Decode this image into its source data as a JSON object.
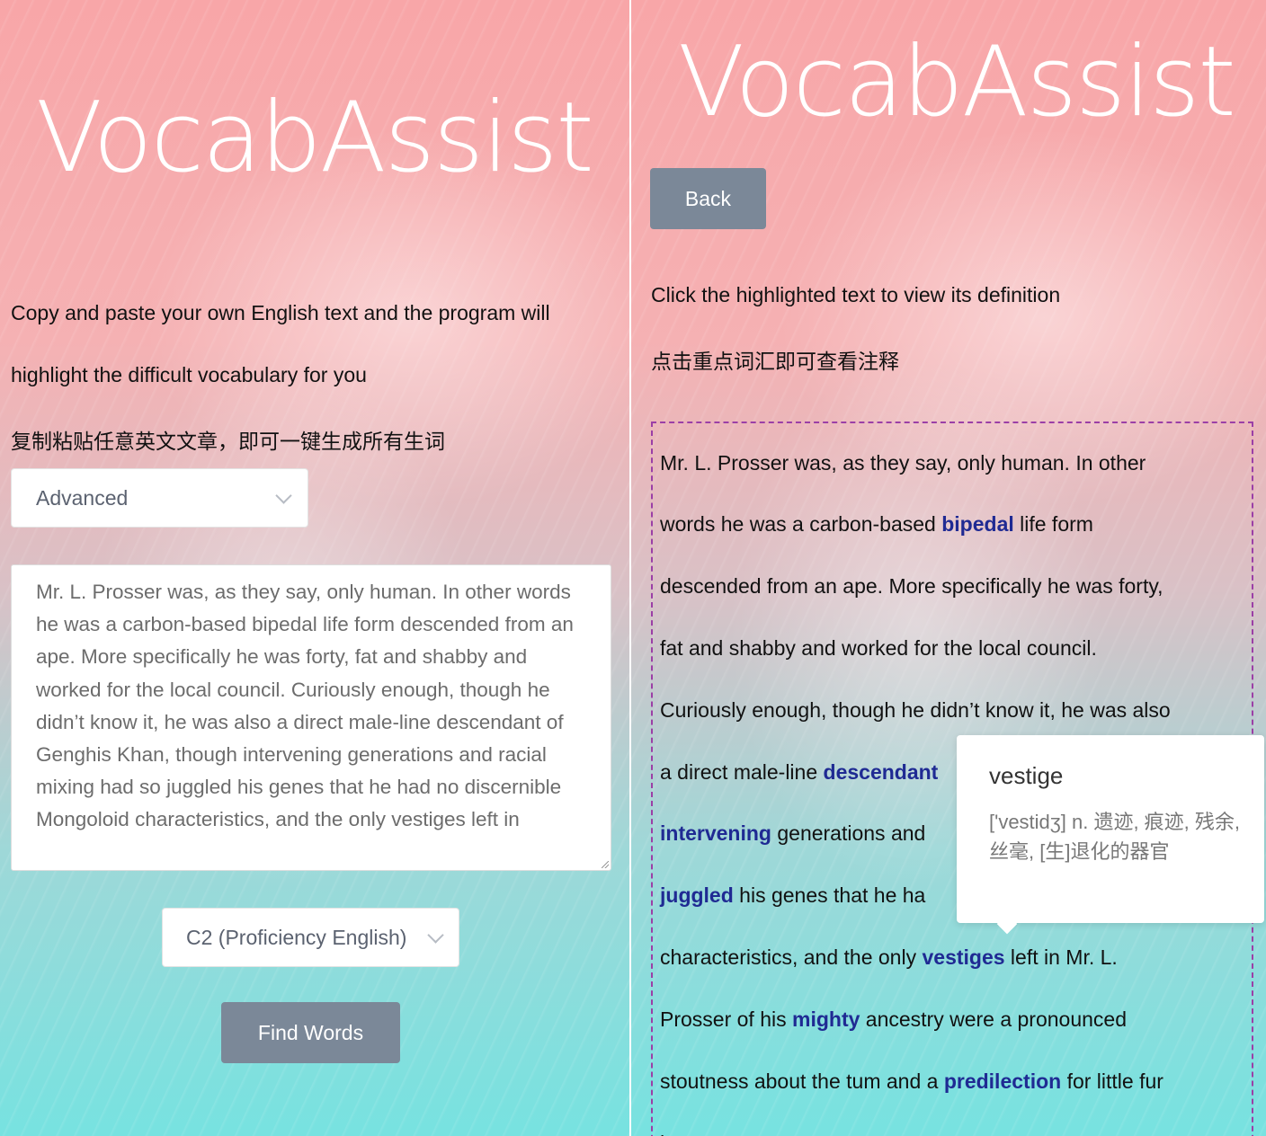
{
  "left": {
    "title": "VocabAssist",
    "intro_line1": "Copy and paste your own English text and the program will",
    "intro_line2": "highlight the difficult vocabulary for you",
    "intro_zh": "复制粘贴任意英文文章，即可一键生成所有生词",
    "level_select": "Advanced",
    "textarea_text": "Mr. L. Prosser was, as they say, only human. In other words he was a carbon-based bipedal life form descended from an ape. More specifically he was forty, fat and shabby and worked for the local council. Curiously enough, though he didn’t know it, he was also a direct male-line descendant of Genghis Khan, though intervening generations and racial mixing had so juggled his genes that he had no discernible Mongoloid characteristics, and the only vestiges left in",
    "exam_select": "C2 (Proficiency English)",
    "find_button": "Find Words"
  },
  "right": {
    "title": "VocabAssist",
    "back_button": "Back",
    "instruction_en": "Click the highlighted text to view its definition",
    "instruction_zh": "点击重点词汇即可查看注释",
    "lines": [
      [
        {
          "t": "Mr. L. Prosser was, as they say, only human. In other"
        }
      ],
      [
        {
          "t": "words he was a carbon-based "
        },
        {
          "t": "bipedal",
          "h": true
        },
        {
          "t": " life form"
        }
      ],
      [
        {
          "t": "descended from an ape. More specifically he was forty,"
        }
      ],
      [
        {
          "t": "fat and shabby and worked for the local council."
        }
      ],
      [
        {
          "t": "Curiously enough, though he didn’t know it, he was also"
        }
      ],
      [
        {
          "t": "a direct male-line "
        },
        {
          "t": "descendant",
          "h": true
        }
      ],
      [
        {
          "t": "intervening",
          "h": true
        },
        {
          "t": " generations and"
        }
      ],
      [
        {
          "t": "juggled",
          "h": true
        },
        {
          "t": " his genes that he ha"
        }
      ],
      [
        {
          "t": "characteristics, and the only "
        },
        {
          "t": "vestiges",
          "h": true
        },
        {
          "t": " left in Mr. L."
        }
      ],
      [
        {
          "t": "Prosser of his "
        },
        {
          "t": "mighty",
          "h": true
        },
        {
          "t": " ancestry were a pronounced"
        }
      ],
      [
        {
          "t": "stoutness about the tum and a "
        },
        {
          "t": "predilection",
          "h": true
        },
        {
          "t": " for little fur"
        }
      ],
      [
        {
          "t": "hats."
        }
      ]
    ],
    "popover": {
      "word": "vestige",
      "definition": "['vestidʒ] n. 遗迹, 痕迹, 残余, 丝毫, [生]退化的器官"
    }
  },
  "colors": {
    "highlight": "#1f2a93",
    "button": "#7b8898",
    "dashed_border": "#9b3fa6"
  }
}
